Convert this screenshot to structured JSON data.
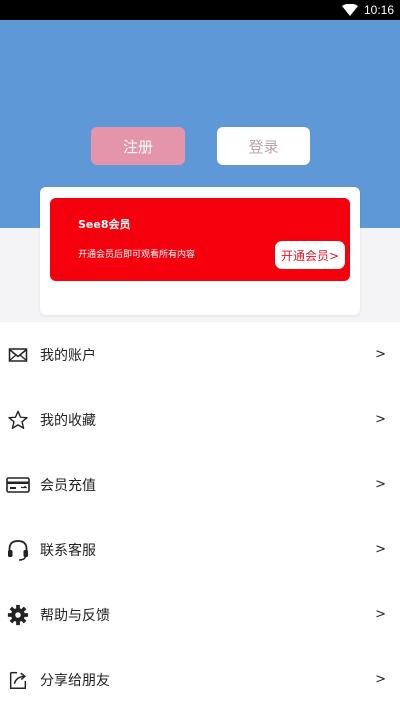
{
  "status_bar": {
    "time": "10:16"
  },
  "header": {
    "register_label": "注册",
    "login_label": "登录",
    "bg_color": "#5e98d7"
  },
  "vip_card": {
    "title": "See8会员",
    "description": "开通会员后即可观看所有内容",
    "button_label": "开通会员>",
    "bg_color": "#f5000d"
  },
  "menu": {
    "items": [
      {
        "label": "我的账户",
        "icon": "envelope-icon",
        "arrow": ">"
      },
      {
        "label": "我的收藏",
        "icon": "star-icon",
        "arrow": ">"
      },
      {
        "label": "会员充值",
        "icon": "card-icon",
        "arrow": ">"
      },
      {
        "label": "联系客服",
        "icon": "headset-icon",
        "arrow": ">"
      },
      {
        "label": "帮助与反馈",
        "icon": "gear-icon",
        "arrow": ">"
      },
      {
        "label": "分享给朋友",
        "icon": "share-icon",
        "arrow": ">"
      }
    ]
  }
}
